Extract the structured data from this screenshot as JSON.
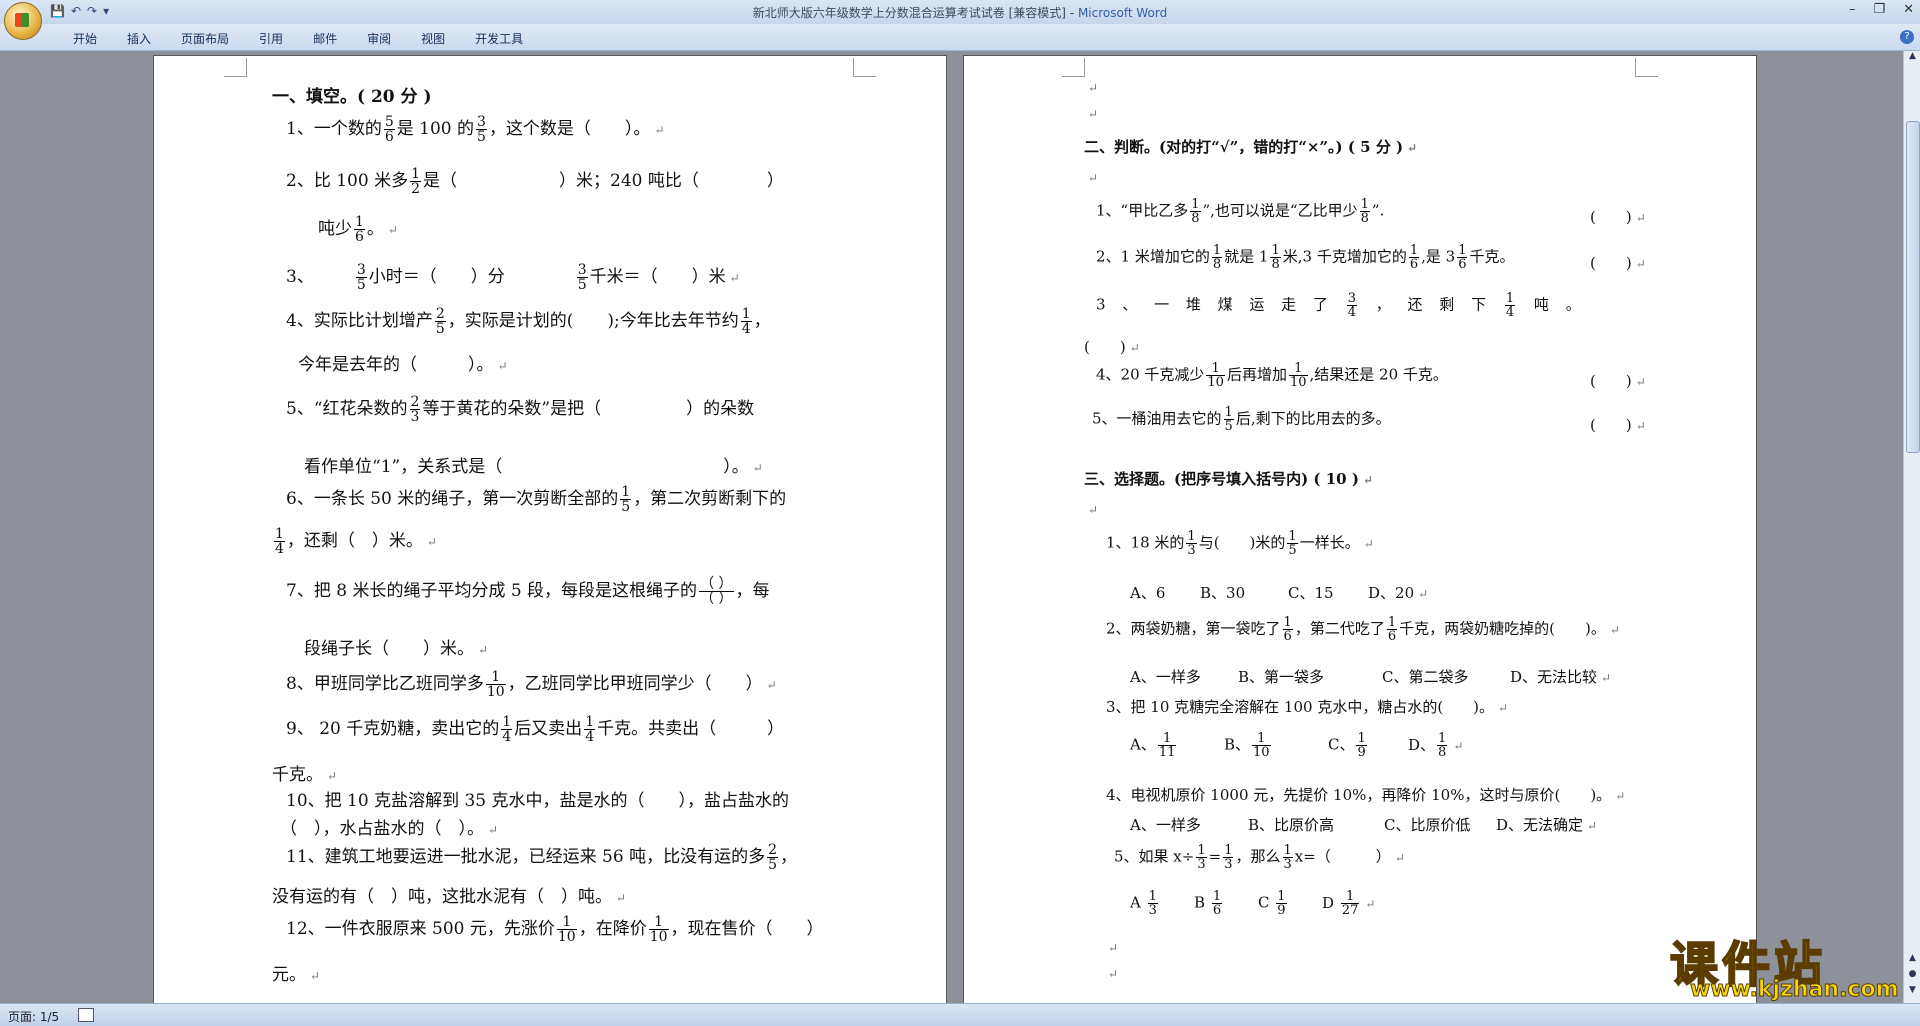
{
  "window": {
    "title": "新北师大版六年级数学上分数混合运算考试试卷 [兼容模式]",
    "app": "Microsoft Word",
    "controls": [
      "–",
      "❐",
      "✕"
    ]
  },
  "qat": [
    "💾",
    "↶",
    "↷",
    "▾"
  ],
  "ribbon": {
    "tabs": [
      "开始",
      "插入",
      "页面布局",
      "引用",
      "邮件",
      "审阅",
      "视图",
      "开发工具"
    ],
    "help": "?"
  },
  "status": {
    "page": "页面: 1/5"
  },
  "watermark": {
    "title": "课件站",
    "url": "www.kjzhan.com"
  },
  "page1": {
    "heading": "一、填空。( 20 分 )",
    "q1": {
      "a": "1、一个数的",
      "f1n": "5",
      "f1d": "6",
      "b": "是 100 的",
      "f2n": "3",
      "f2d": "5",
      "c": "，这个数是（　　）。"
    },
    "q2": {
      "a": "2、比 100 米多",
      "fn": "1",
      "fd": "2",
      "b": "是（　　　　　　）米；240 吨比（　　　　）"
    },
    "q2b": {
      "a": "吨少",
      "fn": "1",
      "fd": "6",
      "b": "。"
    },
    "q3": {
      "a": "3、",
      "f1n": "3",
      "f1d": "5",
      "b": "小时＝（　　）分",
      "f2n": "3",
      "f2d": "5",
      "c": "千米＝（　　）米"
    },
    "q4": {
      "a": "4、实际比计划增产",
      "f1n": "2",
      "f1d": "5",
      "b": "，实际是计划的(　　);今年比去年节约",
      "f2n": "1",
      "f2d": "4",
      "c": "，"
    },
    "q4b": "今年是去年的（　　　）。",
    "q5": {
      "a": "5、“红花朵数的",
      "fn": "2",
      "fd": "3",
      "b": "等于黄花的朵数”是把（　　　　　）的朵数"
    },
    "q5b": "看作单位“1”，关系式是（　　　　　　　　　　　　　）。",
    "q6": {
      "a": "6、一条长 50 米的绳子，第一次剪断全部的",
      "fn": "1",
      "fd": "5",
      "b": "，第二次剪断剩下的"
    },
    "q6b": {
      "fn": "1",
      "fd": "4",
      "b": "，还剩（　）米。"
    },
    "q7": {
      "a": "7、把 8 米长的绳子平均分成 5 段，每段是这根绳子的",
      "fn": "（  ）",
      "fd": "（  ）",
      "b": "，每"
    },
    "q7b": "段绳子长（　　）米。",
    "q8": {
      "a": "8、甲班同学比乙班同学多",
      "fn": "1",
      "fd": "10",
      "b": "，乙班同学比甲班同学少（　　）"
    },
    "q9": {
      "a": "9、 20 千克奶糖，卖出它的",
      "f1n": "1",
      "f1d": "4",
      "b": "后又卖出",
      "f2n": "1",
      "f2d": "4",
      "c": "千克。共卖出（　　　）"
    },
    "q9b": "千克。",
    "q10": "10、把 10 克盐溶解到 35 克水中，盐是水的（　　），盐占盐水的",
    "q10b": "（　），水占盐水的（　）。",
    "q11": {
      "a": "11、建筑工地要运进一批水泥，已经运来 56 吨，比没有运的多",
      "fn": "2",
      "fd": "5",
      "b": "，"
    },
    "q11b": "没有运的有（　）吨，这批水泥有（　）吨。",
    "q12": {
      "a": "12、一件衣服原来 500 元，先涨价",
      "f1n": "1",
      "f1d": "10",
      "b": "，在降价",
      "f2n": "1",
      "f2d": "10",
      "c": "，现在售价（　　）"
    },
    "q12b": "元。"
  },
  "page2": {
    "judge_heading": "二、判断。(对的打“√”，错的打“×”。) ( 5 分 )",
    "j1": {
      "a": "1、“甲比乙多",
      "fn": "1",
      "fd": "8",
      "b": "”,也可以说是“乙比甲少",
      "f2n": "1",
      "f2d": "8",
      "c": "”.",
      "p": "(　　)"
    },
    "j2": {
      "a": "2、1 米增加它的",
      "f1n": "1",
      "f1d": "8",
      "b": "就是 1",
      "f2n": "1",
      "f2d": "8",
      "c": "米,3 千克增加它的",
      "f3n": "1",
      "f3d": "6",
      "d": ",是 3",
      "f4n": "1",
      "f4d": "6",
      "e": "千克。",
      "p": "(　　)"
    },
    "j3": {
      "a": "3 、 一 堆 煤 运 走 了",
      "fn": "3",
      "fd": "4",
      "b": "， 还 剩 下",
      "f2n": "1",
      "f2d": "4",
      "c": "吨 。"
    },
    "j3b": "(　　)",
    "j4": {
      "a": "4、20 千克减少",
      "fn": "1",
      "fd": "10",
      "b": "后再增加",
      "f2n": "1",
      "f2d": "10",
      "c": ",结果还是 20 千克。",
      "p": "(　　)"
    },
    "j5": {
      "a": "5、一桶油用去它的",
      "fn": "1",
      "fd": "5",
      "b": "后,剩下的比用去的多。",
      "p": "(　　)"
    },
    "choice_heading": "三、选择题。(把序号填入括号内) ( 10 )",
    "c1": {
      "a": "1、18 米的",
      "fn": "1",
      "fd": "3",
      "b": "与(　　)米的",
      "f2n": "1",
      "f2d": "5",
      "c": "一样长。"
    },
    "c1o": [
      "A、6",
      "B、30",
      "C、15",
      "D、20"
    ],
    "c2": {
      "a": "2、两袋奶糖，第一袋吃了",
      "fn": "1",
      "fd": "6",
      "b": "，第二代吃了",
      "f2n": "1",
      "f2d": "6",
      "c": "千克，两袋奶糖吃掉的(　　)。"
    },
    "c2o": [
      "A、一样多",
      "B、第一袋多",
      "C、第二袋多",
      "D、无法比较"
    ],
    "c3": "3、把 10 克糖完全溶解在 100 克水中，糖占水的(　　)。",
    "c3o": [
      {
        "l": "A、",
        "n": "1",
        "d": "11"
      },
      {
        "l": "B、",
        "n": "1",
        "d": "10"
      },
      {
        "l": "C、",
        "n": "1",
        "d": "9"
      },
      {
        "l": "D、",
        "n": "1",
        "d": "8"
      }
    ],
    "c4": "4、电视机原价 1000 元，先提价 10%，再降价 10%，这时与原价(　　)。",
    "c4o": [
      "A、一样多",
      "B、比原价高",
      "C、比原价低",
      "D、无法确定"
    ],
    "c5": {
      "a": "5、如果 x÷",
      "fn": "1",
      "fd": "3",
      "b": "=",
      "f2n": "1",
      "f2d": "3",
      "c": "，那么",
      "f3n": "1",
      "f3d": "3",
      "d": "x=（　　　）"
    },
    "c5o": [
      {
        "l": "A",
        "n": "1",
        "d": "3"
      },
      {
        "l": "B",
        "n": "1",
        "d": "6"
      },
      {
        "l": "C",
        "n": "1",
        "d": "9"
      },
      {
        "l": "D",
        "n": "1",
        "d": "27"
      }
    ]
  }
}
